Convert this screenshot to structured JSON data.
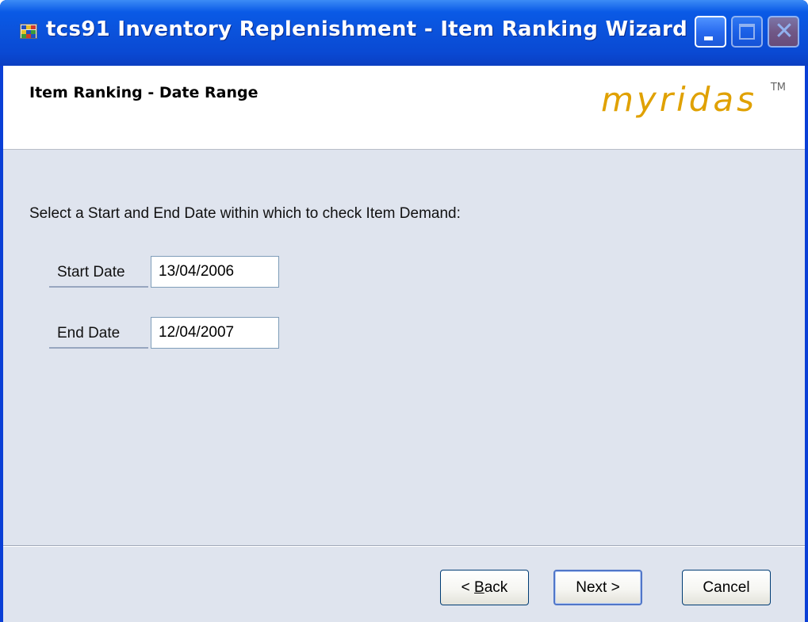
{
  "window": {
    "title": "tcs91 Inventory Replenishment - Item Ranking Wizard"
  },
  "header": {
    "title": "Item Ranking - Date Range",
    "logo_text": "myridas",
    "logo_tm": "TM",
    "logo_color": "#e0a100"
  },
  "main": {
    "instruction": "Select a Start and End Date within which to check Item Demand:",
    "fields": [
      {
        "label": "Start Date",
        "value": "13/04/2006"
      },
      {
        "label": "End Date",
        "value": "12/04/2007"
      }
    ]
  },
  "buttons": {
    "back": {
      "prefix": "< ",
      "mnemonic": "B",
      "rest": "ack"
    },
    "next": "Next >",
    "cancel": "Cancel"
  },
  "icons": {
    "app": "app-grid-icon",
    "minimize": "minimize-icon",
    "maximize": "maximize-icon",
    "close": "close-icon"
  },
  "colors": {
    "titlebar": "#0b52db",
    "client_bg": "#dfe4ee",
    "header_bg": "#ffffff"
  }
}
